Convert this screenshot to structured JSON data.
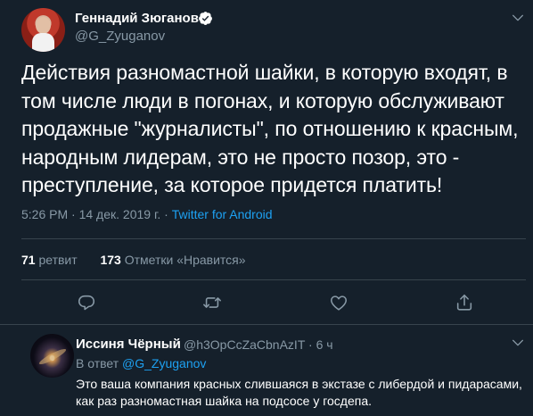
{
  "tweet": {
    "author_name": "Геннадий Зюганов",
    "author_handle": "@G_Zyuganov",
    "text": "Действия разномастной шайки, в которую входят, в том числе люди в погонах, и которую обслуживают продажные \"журналисты\", по отношению к красным, народным лидерам, это не просто позор, это - преступление, за которое придется платить!",
    "time": "5:26 PM",
    "date": "14 дек. 2019 г.",
    "separator": "·",
    "source": "Twitter for Android",
    "retweets_count": "71",
    "retweets_label": "ретвит",
    "likes_count": "173",
    "likes_label": "Отметки «Нравится»"
  },
  "reply": {
    "author_name": "Иссиня Чёрный",
    "author_handle": "@h3OpCcZaCbnAzIT",
    "dot": "·",
    "time_ago": "6 ч",
    "reply_to_prefix": "В ответ",
    "reply_to_mention": "@G_Zyuganov",
    "text": "Это ваша компания красных слившаяся в экстазе с либердой и пидарасами, как раз разномастная шайка на подсосе у госдепа."
  },
  "colors": {
    "background": "#15202b",
    "text": "#ffffff",
    "secondary": "#8899a6",
    "accent": "#1da1f2",
    "divider": "#38444d"
  },
  "icons": [
    "verified-icon",
    "chevron-down-icon",
    "reply-icon",
    "retweet-icon",
    "like-icon",
    "share-icon"
  ]
}
